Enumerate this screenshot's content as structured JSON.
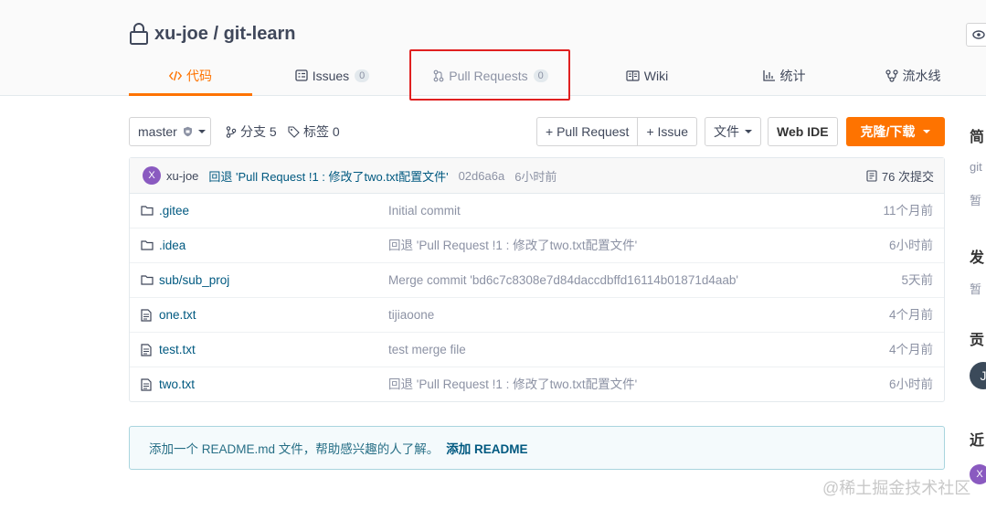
{
  "repo": {
    "owner_and_name": "xu-joe / git-learn"
  },
  "tabs": [
    {
      "label": "代码",
      "icon": "code-icon"
    },
    {
      "label": "Issues",
      "count": "0",
      "icon": "issues-icon"
    },
    {
      "label": "Pull Requests",
      "count": "0",
      "icon": "pull-request-icon"
    },
    {
      "label": "Wiki",
      "icon": "wiki-icon"
    },
    {
      "label": "统计",
      "icon": "stats-icon"
    },
    {
      "label": "流水线",
      "icon": "pipeline-icon"
    }
  ],
  "toolbar": {
    "branch": "master",
    "branches_label": "分支 5",
    "tags_label": "标签 0",
    "pull_request_btn": "+ Pull Request",
    "issue_btn": "+ Issue",
    "file_btn": "文件",
    "webide_btn": "Web IDE",
    "clone_btn": "克隆/下载"
  },
  "latest_commit": {
    "avatar_letter": "X",
    "author": "xu-joe",
    "message": "回退 'Pull Request !1 : 修改了two.txt配置文件'",
    "sha": "02d6a6a",
    "time": "6小时前",
    "count_label": "76 次提交"
  },
  "files": [
    {
      "type": "folder",
      "name": ".gitee",
      "message": "Initial commit",
      "time": "11个月前"
    },
    {
      "type": "folder",
      "name": ".idea",
      "message": "回退 'Pull Request !1 : 修改了two.txt配置文件'",
      "time": "6小时前"
    },
    {
      "type": "folder",
      "name": "sub/sub_proj",
      "message": "Merge commit 'bd6c7c8308e7d84daccdbffd16114b01871d4aab'",
      "time": "5天前"
    },
    {
      "type": "file",
      "name": "one.txt",
      "message": "tijiaoone",
      "time": "4个月前"
    },
    {
      "type": "file",
      "name": "test.txt",
      "message": "test merge file",
      "time": "4个月前"
    },
    {
      "type": "file",
      "name": "two.txt",
      "message": "回退 'Pull Request !1 : 修改了two.txt配置文件'",
      "time": "6小时前"
    }
  ],
  "readme": {
    "text": "添加一个 README.md 文件，帮助感兴趣的人了解。",
    "link": "添加 README"
  },
  "sidebar": {
    "section1": "简",
    "section1_sub1": "git",
    "section1_sub2": "暂",
    "section2": "发",
    "section2_sub": "暂",
    "section3": "贡",
    "section3_avatar_letter": "J",
    "section4": "近",
    "section4_avatar_letter": "X"
  },
  "watermark": "@稀土掘金技术社区",
  "colors": {
    "accent": "#fe7300",
    "link": "#005980",
    "highlight_box": "#e02020",
    "avatar_purple": "#8a5ac0",
    "avatar_dark": "#3b4a5a"
  }
}
